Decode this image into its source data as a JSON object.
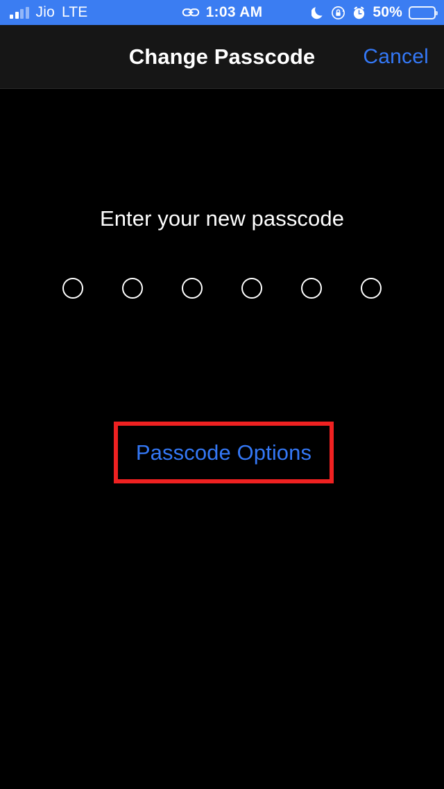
{
  "status_bar": {
    "background_color": "#3b7df2",
    "carrier": "Jio",
    "network_type": "LTE",
    "signal_icon": "signal-bars-icon",
    "signal_bars_total": 4,
    "signal_bars_filled": 2,
    "link_icon": "link-chain-icon",
    "time": "1:03 AM",
    "dnd_icon": "moon-crescent-icon",
    "rotation_lock_icon": "rotation-lock-icon",
    "alarm_icon": "alarm-clock-icon",
    "battery_percent_label": "50%",
    "battery_level": 50,
    "battery_icon": "battery-icon"
  },
  "nav_bar": {
    "title": "Change Passcode",
    "cancel_label": "Cancel",
    "accent_color": "#3478f6",
    "background_color": "#161616"
  },
  "main": {
    "prompt": "Enter your new passcode",
    "passcode": {
      "length": 6,
      "filled": 0,
      "dots": [
        {
          "filled": false
        },
        {
          "filled": false
        },
        {
          "filled": false
        },
        {
          "filled": false
        },
        {
          "filled": false
        },
        {
          "filled": false
        }
      ]
    },
    "passcode_options_label": "Passcode Options",
    "passcode_options_color": "#3478f6",
    "highlight_color": "#ef2121",
    "background_color": "#000000"
  }
}
